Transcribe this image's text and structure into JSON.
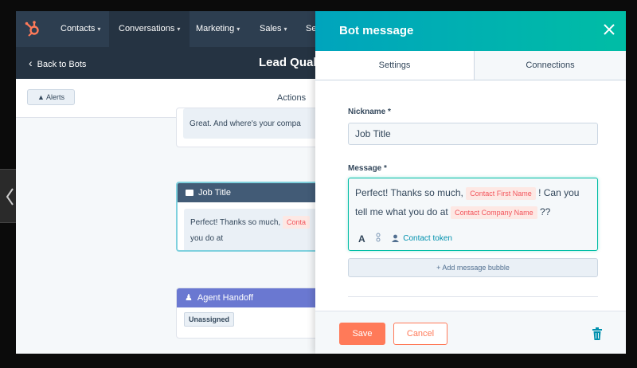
{
  "nav": {
    "items": [
      {
        "label": "Contacts"
      },
      {
        "label": "Conversations"
      },
      {
        "label": "Marketing"
      },
      {
        "label": "Sales"
      },
      {
        "label": "Ser"
      }
    ]
  },
  "subbar": {
    "back_label": "Back to Bots",
    "title": "Lead Qual"
  },
  "toolbar": {
    "alerts_label": "Alerts",
    "actions_label": "Actions"
  },
  "canvas": {
    "card_top_text": "Great. And where's your compa",
    "job_title_card": {
      "title": "Job Title",
      "text_1": "Perfect! Thanks so much,",
      "chip": "Conta",
      "text_2": "you do at"
    },
    "agent_card": {
      "title": "Agent Handoff",
      "badge": "Unassigned"
    }
  },
  "panel": {
    "title": "Bot message",
    "tabs": [
      {
        "label": "Settings"
      },
      {
        "label": "Connections"
      }
    ],
    "nickname_label": "Nickname *",
    "nickname_value": "Job Title",
    "message_label": "Message *",
    "message": {
      "text_1": "Perfect! Thanks so much,",
      "token_1": "Contact First Name",
      "text_2": "! Can you tell me what you do at",
      "token_2": "Contact Company Name",
      "text_3": "??"
    },
    "tools": {
      "format": "A",
      "contact_token": "Contact token"
    },
    "add_bubble_label": "+ Add message bubble",
    "save_label": "Save",
    "cancel_label": "Cancel"
  },
  "colors": {
    "nav_bg": "#2d3e50",
    "header_gradient_start": "#00a4bd",
    "header_gradient_end": "#00bda5",
    "accent_orange": "#ff7a59",
    "job_title_header": "#425b76",
    "agent_header": "#6a78d1"
  }
}
